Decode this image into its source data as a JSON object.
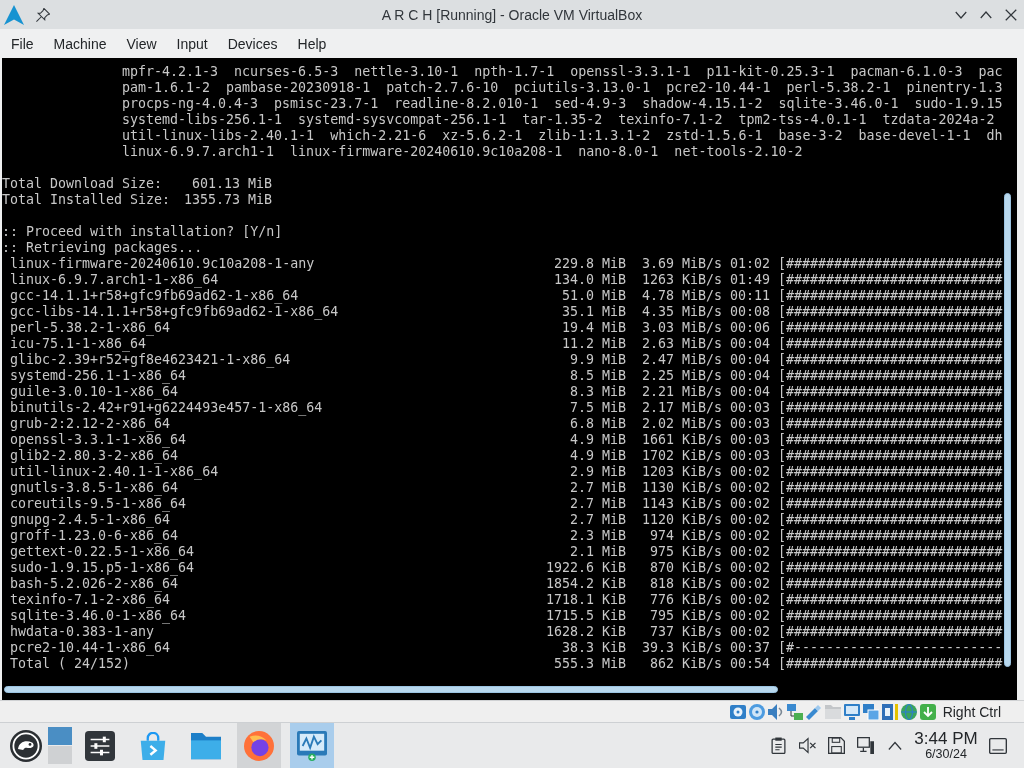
{
  "window": {
    "title": "A R C H [Running] - Oracle VM VirtualBox"
  },
  "menu": [
    "File",
    "Machine",
    "View",
    "Input",
    "Devices",
    "Help"
  ],
  "terminal": {
    "package_lines": [
      "mpfr-4.2.1-3  ncurses-6.5-3  nettle-3.10-1  npth-1.7-1  openssl-3.3.1-1  p11-kit-0.25.3-1  pacman-6.1.0-3  pac",
      "pam-1.6.1-2  pambase-20230918-1  patch-2.7.6-10  pciutils-3.13.0-1  pcre2-10.44-1  perl-5.38.2-1  pinentry-1.3",
      "procps-ng-4.0.4-3  psmisc-23.7-1  readline-8.2.010-1  sed-4.9-3  shadow-4.15.1-2  sqlite-3.46.0-1  sudo-1.9.15",
      "systemd-libs-256.1-1  systemd-sysvcompat-256.1-1  tar-1.35-2  texinfo-7.1-2  tpm2-tss-4.0.1-1  tzdata-2024a-2",
      "util-linux-libs-2.40.1-1  which-2.21-6  xz-5.6.2-1  zlib-1:1.3.1-2  zstd-1.5.6-1  base-3-2  base-devel-1-1  dh",
      "linux-6.9.7.arch1-1  linux-firmware-20240610.9c10a208-1  nano-8.0-1  net-tools-2.10-2"
    ],
    "totals": [
      {
        "label": "Total Download Size:",
        "value": "601.13 MiB"
      },
      {
        "label": "Total Installed Size:",
        "value": "1355.73 MiB"
      }
    ],
    "messages": [
      ":: Proceed with installation? [Y/n]",
      ":: Retrieving packages..."
    ],
    "downloads": [
      {
        "package": "linux-firmware-20240610.9c10a208-1-any",
        "size": "229.8 MiB",
        "speed": "3.69 MiB/s",
        "time": "01:02",
        "bar": "[###########################"
      },
      {
        "package": "linux-6.9.7.arch1-1-x86_64",
        "size": "134.0 MiB",
        "speed": "1263 KiB/s",
        "time": "01:49",
        "bar": "[###########################"
      },
      {
        "package": "gcc-14.1.1+r58+gfc9fb69ad62-1-x86_64",
        "size": "51.0 MiB",
        "speed": "4.78 MiB/s",
        "time": "00:11",
        "bar": "[###########################"
      },
      {
        "package": "gcc-libs-14.1.1+r58+gfc9fb69ad62-1-x86_64",
        "size": "35.1 MiB",
        "speed": "4.35 MiB/s",
        "time": "00:08",
        "bar": "[###########################"
      },
      {
        "package": "perl-5.38.2-1-x86_64",
        "size": "19.4 MiB",
        "speed": "3.03 MiB/s",
        "time": "00:06",
        "bar": "[###########################"
      },
      {
        "package": "icu-75.1-1-x86_64",
        "size": "11.2 MiB",
        "speed": "2.63 MiB/s",
        "time": "00:04",
        "bar": "[###########################"
      },
      {
        "package": "glibc-2.39+r52+gf8e4623421-1-x86_64",
        "size": "9.9 MiB",
        "speed": "2.47 MiB/s",
        "time": "00:04",
        "bar": "[###########################"
      },
      {
        "package": "systemd-256.1-1-x86_64",
        "size": "8.5 MiB",
        "speed": "2.25 MiB/s",
        "time": "00:04",
        "bar": "[###########################"
      },
      {
        "package": "guile-3.0.10-1-x86_64",
        "size": "8.3 MiB",
        "speed": "2.21 MiB/s",
        "time": "00:04",
        "bar": "[###########################"
      },
      {
        "package": "binutils-2.42+r91+g6224493e457-1-x86_64",
        "size": "7.5 MiB",
        "speed": "2.17 MiB/s",
        "time": "00:03",
        "bar": "[###########################"
      },
      {
        "package": "grub-2:2.12-2-x86_64",
        "size": "6.8 MiB",
        "speed": "2.02 MiB/s",
        "time": "00:03",
        "bar": "[###########################"
      },
      {
        "package": "openssl-3.3.1-1-x86_64",
        "size": "4.9 MiB",
        "speed": "1661 KiB/s",
        "time": "00:03",
        "bar": "[###########################"
      },
      {
        "package": "glib2-2.80.3-2-x86_64",
        "size": "4.9 MiB",
        "speed": "1702 KiB/s",
        "time": "00:03",
        "bar": "[###########################"
      },
      {
        "package": "util-linux-2.40.1-1-x86_64",
        "size": "2.9 MiB",
        "speed": "1203 KiB/s",
        "time": "00:02",
        "bar": "[###########################"
      },
      {
        "package": "gnutls-3.8.5-1-x86_64",
        "size": "2.7 MiB",
        "speed": "1130 KiB/s",
        "time": "00:02",
        "bar": "[###########################"
      },
      {
        "package": "coreutils-9.5-1-x86_64",
        "size": "2.7 MiB",
        "speed": "1143 KiB/s",
        "time": "00:02",
        "bar": "[###########################"
      },
      {
        "package": "gnupg-2.4.5-1-x86_64",
        "size": "2.7 MiB",
        "speed": "1120 KiB/s",
        "time": "00:02",
        "bar": "[###########################"
      },
      {
        "package": "groff-1.23.0-6-x86_64",
        "size": "2.3 MiB",
        "speed": "974 KiB/s",
        "time": "00:02",
        "bar": "[###########################"
      },
      {
        "package": "gettext-0.22.5-1-x86_64",
        "size": "2.1 MiB",
        "speed": "975 KiB/s",
        "time": "00:02",
        "bar": "[###########################"
      },
      {
        "package": "sudo-1.9.15.p5-1-x86_64",
        "size": "1922.6 KiB",
        "speed": "870 KiB/s",
        "time": "00:02",
        "bar": "[###########################"
      },
      {
        "package": "bash-5.2.026-2-x86_64",
        "size": "1854.2 KiB",
        "speed": "818 KiB/s",
        "time": "00:02",
        "bar": "[###########################"
      },
      {
        "package": "texinfo-7.1-2-x86_64",
        "size": "1718.1 KiB",
        "speed": "776 KiB/s",
        "time": "00:02",
        "bar": "[###########################"
      },
      {
        "package": "sqlite-3.46.0-1-x86_64",
        "size": "1715.5 KiB",
        "speed": "795 KiB/s",
        "time": "00:02",
        "bar": "[###########################"
      },
      {
        "package": "hwdata-0.383-1-any",
        "size": "1628.2 KiB",
        "speed": "737 KiB/s",
        "time": "00:02",
        "bar": "[###########################"
      },
      {
        "package": "pcre2-10.44-1-x86_64",
        "size": "38.3 KiB",
        "speed": "39.3 KiB/s",
        "time": "00:37",
        "bar": "[#--------------------------"
      }
    ],
    "total": {
      "label": "Total ( 24/152)",
      "size": "555.3 MiB",
      "speed": "862 KiB/s",
      "time": "00:54",
      "bar": "[###########################"
    }
  },
  "status_bar": {
    "host_key": "Right Ctrl"
  },
  "taskbar": {
    "pager": {
      "desktops": [
        {
          "selected": true
        },
        {
          "selected": false
        }
      ]
    },
    "tasks": [
      {
        "kind": "settings",
        "running": false,
        "selected": false
      },
      {
        "kind": "store",
        "running": false,
        "selected": false
      },
      {
        "kind": "files",
        "running": false,
        "selected": false
      },
      {
        "kind": "browser",
        "running": true,
        "selected": false
      },
      {
        "kind": "vm",
        "running": true,
        "selected": true
      }
    ],
    "tray": {
      "muted": true
    },
    "clock": {
      "time": "3:44 PM",
      "date": "6/30/24"
    }
  }
}
